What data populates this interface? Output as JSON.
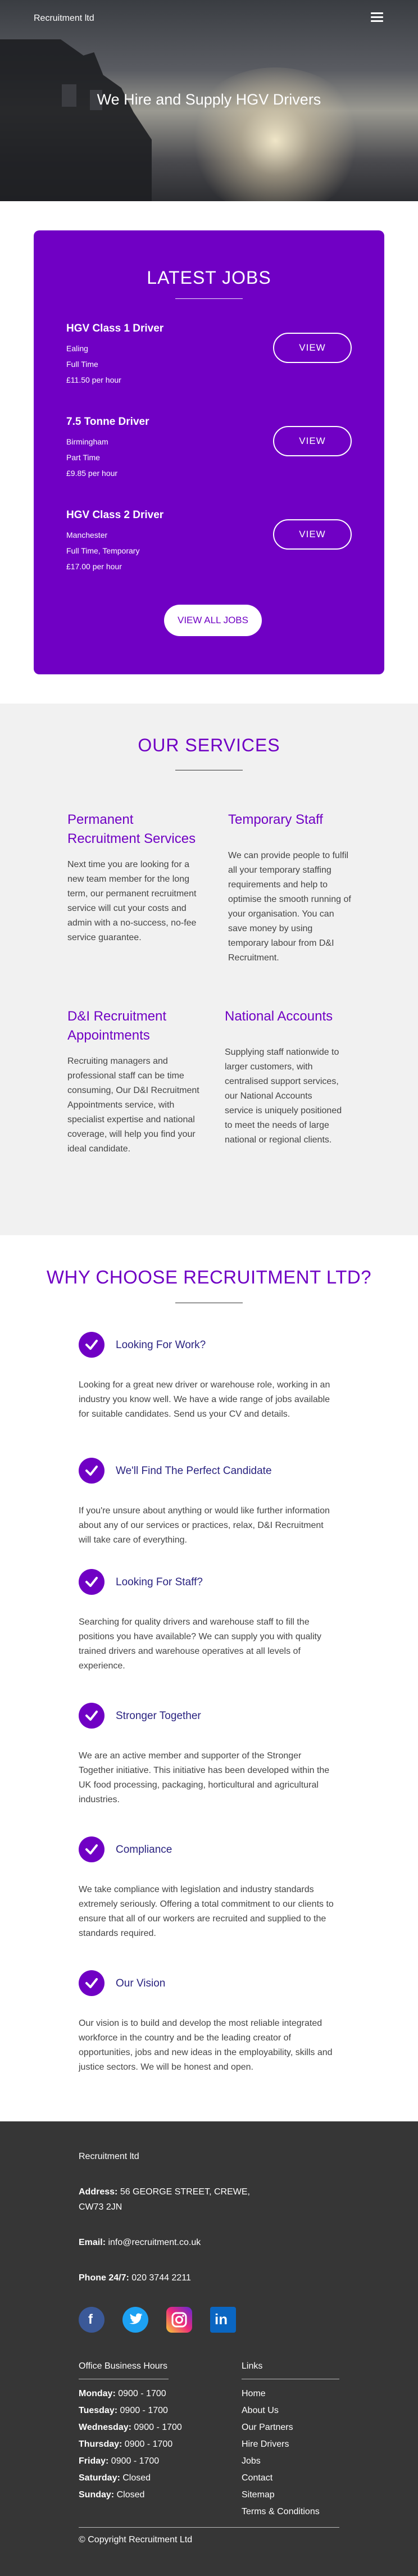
{
  "header": {
    "brand": "Recruitment ltd",
    "title": "We Hire and Supply HGV Drivers"
  },
  "jobs": {
    "heading": "LATEST JOBS",
    "items": [
      {
        "title": "HGV Class 1 Driver",
        "location": "Ealing",
        "type": "Full Time",
        "pay": "£11.50 per hour",
        "button": "VIEW"
      },
      {
        "title": "7.5 Tonne Driver",
        "location": "Birmingham",
        "type": "Part Time",
        "pay": "£9.85 per hour",
        "button": "VIEW"
      },
      {
        "title": "HGV Class 2 Driver",
        "location": "Manchester",
        "type": "Full Time, Temporary",
        "pay": "£17.00 per hour",
        "button": "VIEW"
      }
    ],
    "view_all": "VIEW ALL JOBS"
  },
  "services": {
    "heading": "OUR SERVICES",
    "items": [
      {
        "title": "Permanent Recruitment Services",
        "text": "Next time you are looking for a new team member for the long term, our permanent recruitment service will cut your costs and admin with a no-success, no-fee service guarantee."
      },
      {
        "title": "Temporary Staff",
        "text": "We can provide people to fulfil all your temporary staffing requirements and help to optimise the smooth running of your organisation. You can save money by using temporary labour from D&I Recruitment."
      },
      {
        "title": "D&I Recruitment Appointments",
        "text": "Recruiting managers and professional staff can be time consuming, Our D&I Recruitment Appointments service, with specialist expertise and national coverage, will help you find your ideal candidate."
      },
      {
        "title": "National Accounts",
        "text": "Supplying staff nationwide to larger customers, with centralised support services, our National Accounts service is uniquely positioned to meet the needs of large national or regional clients."
      }
    ]
  },
  "why": {
    "heading": "WHY CHOOSE RECRUITMENT LTD?",
    "items": [
      {
        "title": "Looking For Work?",
        "text": "Looking for a great new driver or warehouse role, working in an industry you know well. We have a wide range of jobs available for suitable candidates. Send us your CV and details."
      },
      {
        "title": "We'll Find The Perfect Candidate",
        "text": "If you're unsure about anything or would like further information about any of our services or practices, relax, D&I Recruitment will take care of everything."
      },
      {
        "title": "Looking For Staff?",
        "text": "Searching for quality drivers and warehouse staff to fill the positions you have available? We can supply you with quality trained drivers and warehouse operatives at all levels of experience."
      },
      {
        "title": "Stronger Together",
        "text": "We are an active member and supporter of the Stronger Together initiative. This initiative has been developed within the UK food processing, packaging, horticultural and agricultural industries."
      },
      {
        "title": "Compliance",
        "text": "We take compliance with legislation and industry standards extremely seriously. Offering a total commitment to our clients to ensure that all of our workers are recruited and supplied to the standards required."
      },
      {
        "title": "Our Vision",
        "text": "Our vision is to build and develop the most reliable integrated workforce in the country and be the leading creator of opportunities, jobs and new ideas in the employability, skills and justice sectors. We will be honest and open."
      }
    ]
  },
  "footer": {
    "company": "Recruitment ltd",
    "address_label": "Address:",
    "address_line1": "56 GEORGE STREET, CREWE,",
    "address_line2": "CW73 2JN",
    "email_label": "Email:",
    "email": "info@recruitment.co.uk",
    "phone_label": "Phone 24/7:",
    "phone": "020 3744 2211",
    "social": {
      "facebook": "f",
      "linkedin": "in"
    },
    "hours_heading": "Office Business Hours",
    "hours": [
      {
        "day": "Monday:",
        "time": "0900 - 1700"
      },
      {
        "day": "Tuesday:",
        "time": "0900 - 1700"
      },
      {
        "day": "Wednesday:",
        "time": "0900 - 1700"
      },
      {
        "day": "Thursday:",
        "time": "0900 - 1700"
      },
      {
        "day": "Friday:",
        "time": "0900 - 1700"
      },
      {
        "day": "Saturday:",
        "time": "Closed"
      },
      {
        "day": "Sunday:",
        "time": "Closed"
      }
    ],
    "links_heading": "Links",
    "links": [
      "Home",
      "About Us",
      "Our Partners",
      "Hire Drivers",
      "Jobs",
      "Contact",
      "Sitemap",
      "Terms & Conditions"
    ],
    "copyright": "© Copyright Recruitment Ltd"
  },
  "colors": {
    "accent": "#7000c4",
    "footer_bg": "#363636",
    "services_bg": "#f1f1f1",
    "heading_dark": "#2a2380"
  },
  "icons": [
    "menu-icon",
    "check-icon",
    "facebook-icon",
    "twitter-icon",
    "instagram-icon",
    "linkedin-icon"
  ]
}
